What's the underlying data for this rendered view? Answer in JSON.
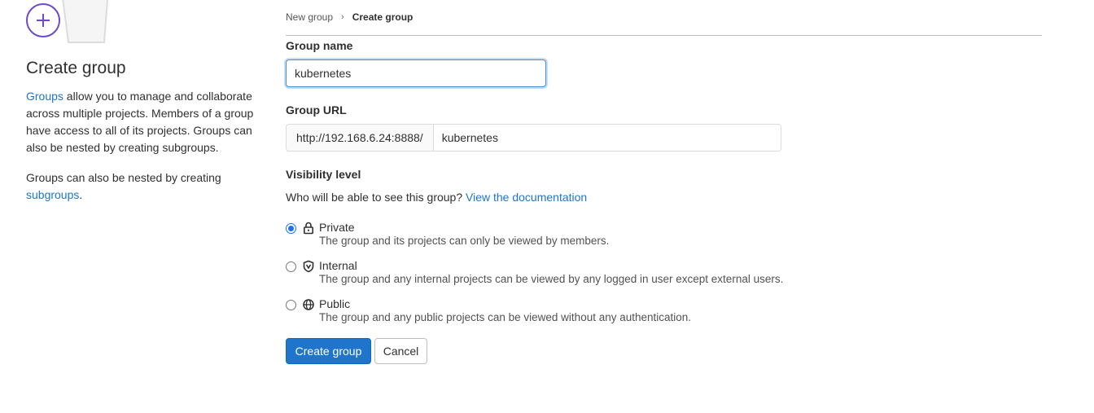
{
  "sidebar": {
    "title": "Create group",
    "description_link": "Groups",
    "description_rest": " allow you to manage and collaborate across multiple projects. Members of a group have access to all of its projects. Groups can also be nested by creating subgroups.",
    "nested_text": "Groups can also be nested by creating ",
    "nested_link": "subgroups",
    "nested_end": "."
  },
  "breadcrumb": {
    "parent": "New group",
    "separator": "›",
    "current": "Create group"
  },
  "form": {
    "group_name_label": "Group name",
    "group_name_value": "kubernetes",
    "group_url_label": "Group URL",
    "group_url_prefix": "http://192.168.6.24:8888/",
    "group_url_value": "kubernetes",
    "visibility_label": "Visibility level",
    "visibility_help": "Who will be able to see this group? ",
    "visibility_help_link": "View the documentation",
    "visibility_options": [
      {
        "title": "Private",
        "desc": "The group and its projects can only be viewed by members.",
        "icon": "lock-icon",
        "checked": true
      },
      {
        "title": "Internal",
        "desc": "The group and any internal projects can be viewed by any logged in user except external users.",
        "icon": "shield-icon",
        "checked": false
      },
      {
        "title": "Public",
        "desc": "The group and any public projects can be viewed without any authentication.",
        "icon": "globe-icon",
        "checked": false
      }
    ],
    "submit_label": "Create group",
    "cancel_label": "Cancel"
  },
  "colors": {
    "primary": "#1f75cb",
    "accent_purple": "#6e49cb"
  }
}
